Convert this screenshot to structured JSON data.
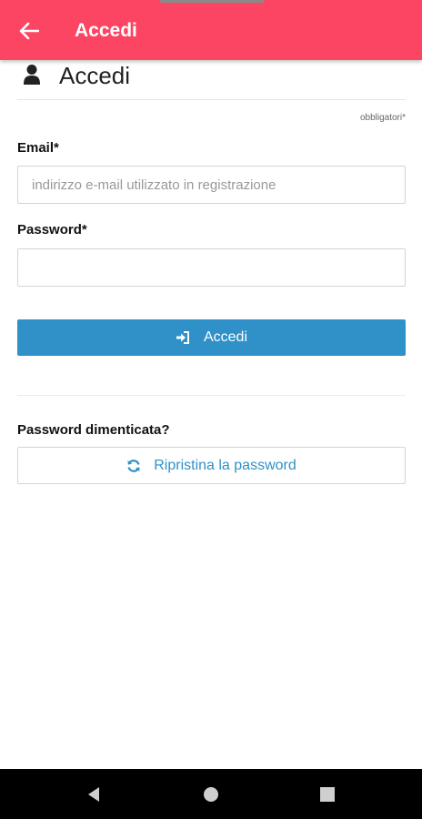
{
  "appbar": {
    "title": "Accedi",
    "background": "#fb4563",
    "back_icon": "arrow-left-icon"
  },
  "header": {
    "icon": "user-icon",
    "title": "Accedi"
  },
  "form": {
    "required_note": "obbligatori*",
    "email": {
      "label": "Email*",
      "value": "",
      "placeholder": "indirizzo e-mail utilizzato in registrazione"
    },
    "password": {
      "label": "Password*",
      "value": "",
      "placeholder": ""
    },
    "submit": {
      "label": "Accedi",
      "icon": "sign-in-icon",
      "color": "#2f91c8"
    }
  },
  "forgot": {
    "label": "Password dimenticata?",
    "reset_button": {
      "label": "Ripristina la password",
      "icon": "refresh-icon"
    }
  },
  "system_nav": {
    "back": "nav-back-icon",
    "home": "nav-home-icon",
    "recents": "nav-recents-icon"
  }
}
